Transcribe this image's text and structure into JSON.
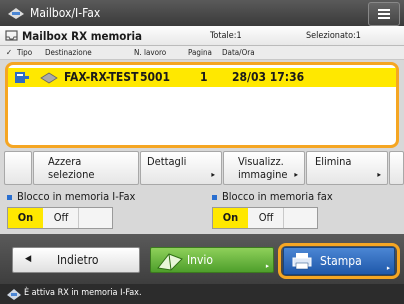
{
  "header": {
    "title": "Mailbox/I-Fax"
  },
  "box": {
    "name": "Mailbox RX memoria",
    "total": "Totale:1",
    "selected": "Selezionato:1"
  },
  "columns": {
    "type": "Tipo",
    "destination": "Destinazione",
    "job_no": "N. lavoro",
    "pages": "Pagina",
    "datetime": "Data/Ora"
  },
  "rows": [
    {
      "destination": "FAX-RX-TEST",
      "job_no": "5001",
      "pages": "1",
      "datetime": "28/03  17:36"
    }
  ],
  "actions": {
    "clear_selection": "Azzera\nselezione",
    "details": "Dettagli",
    "preview": "Visualizz.\nimmagine",
    "delete": "Elimina"
  },
  "memory": {
    "ifax_label": "Blocco in memoria I-Fax",
    "ifax_on": "On",
    "ifax_off": "Off",
    "fax_label": "Blocco in memoria fax",
    "fax_on": "On",
    "fax_off": "Off"
  },
  "bottom": {
    "back": "Indietro",
    "send": "Invio",
    "print": "Stampa"
  },
  "status": {
    "text": "È attiva RX in memoria I-Fax."
  },
  "colors": {
    "accent_yellow": "#ffe800",
    "focus_orange": "#f5a623",
    "send_green": "#5fb233",
    "print_blue": "#2d6bc4"
  }
}
